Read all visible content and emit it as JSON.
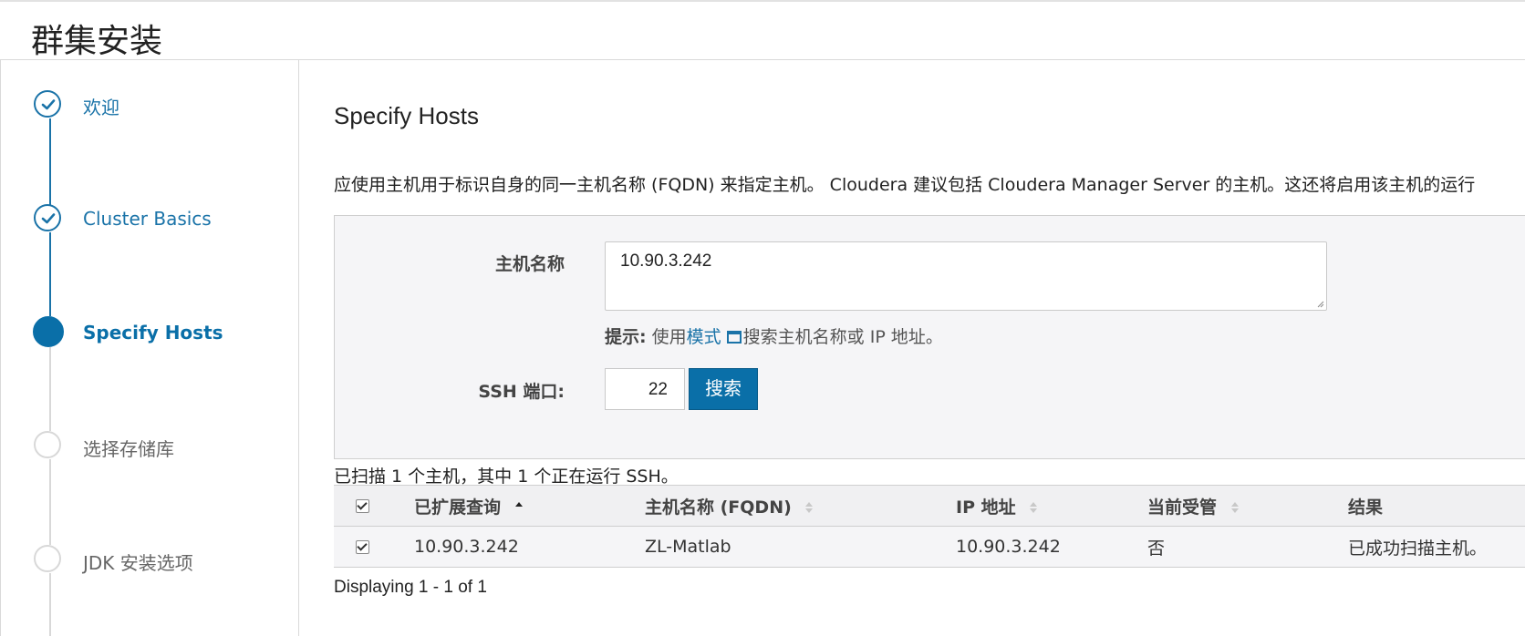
{
  "header": {
    "title": "群集安装"
  },
  "steps": [
    {
      "label": "欢迎",
      "state": "done"
    },
    {
      "label": "Cluster Basics",
      "state": "done"
    },
    {
      "label": "Specify Hosts",
      "state": "active"
    },
    {
      "label": "选择存储库",
      "state": "todo"
    },
    {
      "label": "JDK 安装选项",
      "state": "todo"
    }
  ],
  "main": {
    "title": "Specify Hosts",
    "description": "应使用主机用于标识自身的同一主机名称 (FQDN) 来指定主机。 Cloudera 建议包括 Cloudera Manager Server 的主机。这还将启用该主机的运行",
    "hostname_label": "主机名称",
    "hostname_value": "10.90.3.242",
    "hint_prefix": "提示:",
    "hint_use": " 使用",
    "hint_link": "模式",
    "hint_suffix": "搜索主机名称或 IP 地址。",
    "ssh_port_label": "SSH 端口:",
    "ssh_port_value": "22",
    "search_button": "搜索",
    "scan_summary": "已扫描 1 个主机，其中 1 个正在运行 SSH。",
    "displaying": "Displaying 1 - 1 of 1"
  },
  "table": {
    "columns": [
      "已扩展查询",
      "主机名称 (FQDN)",
      "IP 地址",
      "当前受管",
      "结果"
    ],
    "header_checked": true,
    "rows": [
      {
        "checked": true,
        "query": "10.90.3.242",
        "fqdn": "ZL-Matlab",
        "ip": "10.90.3.242",
        "managed": "否",
        "result": "已成功扫描主机。"
      }
    ]
  },
  "colors": {
    "accent": "#0a6fa8",
    "done": "#1a73a8",
    "inactive": "#d8d8d8"
  }
}
